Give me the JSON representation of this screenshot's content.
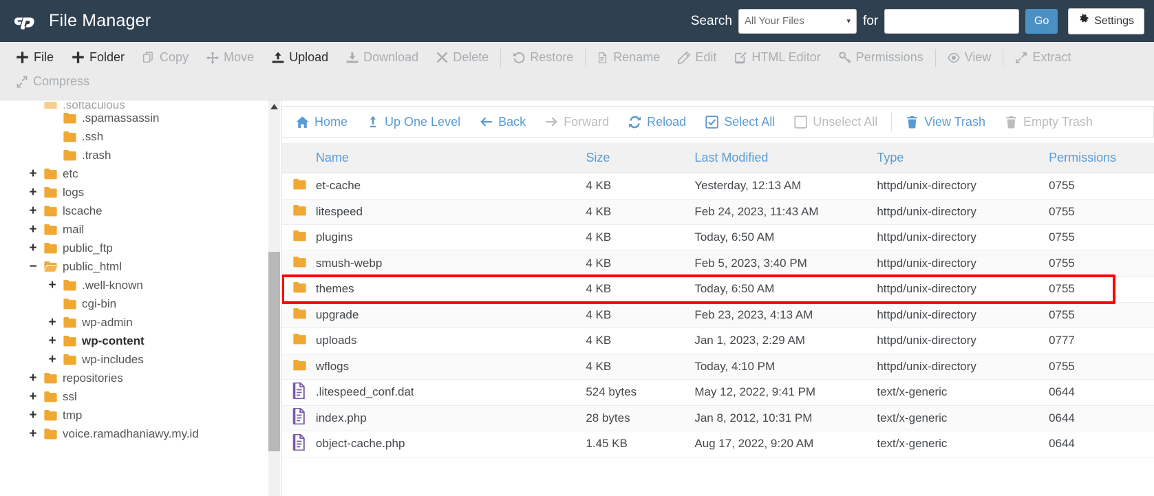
{
  "header": {
    "logo_icon": "cpanel-logo-icon",
    "title": "File Manager",
    "search_label": "Search",
    "search_scope_selected": "All Your Files",
    "search_for_label": "for",
    "search_value": "",
    "search_placeholder": "",
    "go_label": "Go",
    "settings_label": "Settings",
    "settings_icon": "gear-icon",
    "bg_color": "#2f4050",
    "go_color": "#4a90c4"
  },
  "toolbar": {
    "items": [
      {
        "label": "File",
        "icon": "plus-icon",
        "enabled": true
      },
      {
        "label": "Folder",
        "icon": "plus-icon",
        "enabled": true
      },
      {
        "label": "Copy",
        "icon": "copy-icon",
        "enabled": false
      },
      {
        "label": "Move",
        "icon": "move-arrows-icon",
        "enabled": false
      },
      {
        "label": "Upload",
        "icon": "upload-icon",
        "enabled": true
      },
      {
        "label": "Download",
        "icon": "download-icon",
        "enabled": false
      },
      {
        "label": "Delete",
        "icon": "close-x-icon",
        "enabled": false
      },
      {
        "label": "Restore",
        "icon": "restore-undo-icon",
        "enabled": false
      },
      {
        "label": "Rename",
        "icon": "file-icon",
        "enabled": false
      },
      {
        "label": "Edit",
        "icon": "pencil-icon",
        "enabled": false
      },
      {
        "label": "HTML Editor",
        "icon": "html-editor-icon",
        "enabled": false
      },
      {
        "label": "Permissions",
        "icon": "key-icon",
        "enabled": false
      },
      {
        "label": "View",
        "icon": "eye-icon",
        "enabled": false
      },
      {
        "label": "Extract",
        "icon": "extract-arrows-icon",
        "enabled": false
      }
    ],
    "row2": [
      {
        "label": "Compress",
        "icon": "compress-arrows-icon",
        "enabled": false
      }
    ]
  },
  "sidebar": {
    "items": [
      {
        "label": ".softaculous",
        "expander": "",
        "indent": 0,
        "clipped": true,
        "bold": false,
        "open": false
      },
      {
        "label": ".spamassassin",
        "expander": "",
        "indent": 1,
        "clipped": false,
        "bold": false,
        "open": false
      },
      {
        "label": ".ssh",
        "expander": "",
        "indent": 1,
        "clipped": false,
        "bold": false,
        "open": false
      },
      {
        "label": ".trash",
        "expander": "",
        "indent": 1,
        "clipped": false,
        "bold": false,
        "open": false
      },
      {
        "label": "etc",
        "expander": "+",
        "indent": 0,
        "clipped": false,
        "bold": false,
        "open": false
      },
      {
        "label": "logs",
        "expander": "+",
        "indent": 0,
        "clipped": false,
        "bold": false,
        "open": false
      },
      {
        "label": "lscache",
        "expander": "+",
        "indent": 0,
        "clipped": false,
        "bold": false,
        "open": false
      },
      {
        "label": "mail",
        "expander": "+",
        "indent": 0,
        "clipped": false,
        "bold": false,
        "open": false
      },
      {
        "label": "public_ftp",
        "expander": "+",
        "indent": 0,
        "clipped": false,
        "bold": false,
        "open": false
      },
      {
        "label": "public_html",
        "expander": "−",
        "indent": 0,
        "clipped": false,
        "bold": false,
        "open": true
      },
      {
        "label": ".well-known",
        "expander": "+",
        "indent": 1,
        "clipped": false,
        "bold": false,
        "open": false
      },
      {
        "label": "cgi-bin",
        "expander": "",
        "indent": 1,
        "clipped": false,
        "bold": false,
        "open": false
      },
      {
        "label": "wp-admin",
        "expander": "+",
        "indent": 1,
        "clipped": false,
        "bold": false,
        "open": false
      },
      {
        "label": "wp-content",
        "expander": "+",
        "indent": 1,
        "clipped": false,
        "bold": true,
        "open": false
      },
      {
        "label": "wp-includes",
        "expander": "+",
        "indent": 1,
        "clipped": false,
        "bold": false,
        "open": false
      },
      {
        "label": "repositories",
        "expander": "+",
        "indent": 0,
        "clipped": false,
        "bold": false,
        "open": false
      },
      {
        "label": "ssl",
        "expander": "+",
        "indent": 0,
        "clipped": false,
        "bold": false,
        "open": false
      },
      {
        "label": "tmp",
        "expander": "+",
        "indent": 0,
        "clipped": false,
        "bold": false,
        "open": false
      },
      {
        "label": "voice.ramadhaniawy.my.id",
        "expander": "+",
        "indent": 0,
        "clipped": false,
        "bold": false,
        "open": false
      }
    ]
  },
  "navbar": {
    "items": [
      {
        "label": "Home",
        "icon": "home-icon",
        "enabled": true
      },
      {
        "label": "Up One Level",
        "icon": "up-arrow-icon",
        "enabled": true
      },
      {
        "label": "Back",
        "icon": "arrow-left-icon",
        "enabled": true
      },
      {
        "label": "Forward",
        "icon": "arrow-right-icon",
        "enabled": false
      },
      {
        "label": "Reload",
        "icon": "reload-icon",
        "enabled": true
      },
      {
        "label": "Select All",
        "icon": "checkbox-checked-icon",
        "enabled": true
      },
      {
        "label": "Unselect All",
        "icon": "checkbox-empty-icon",
        "enabled": false
      }
    ],
    "trash_items": [
      {
        "label": "View Trash",
        "icon": "trash-icon",
        "enabled": true
      },
      {
        "label": "Empty Trash",
        "icon": "trash-icon",
        "enabled": false
      }
    ]
  },
  "table": {
    "columns": [
      "Name",
      "Size",
      "Last Modified",
      "Type",
      "Permissions"
    ],
    "rows": [
      {
        "icon": "folder-icon",
        "name": "et-cache",
        "size": "4 KB",
        "modified": "Yesterday, 12:13 AM",
        "type": "httpd/unix-directory",
        "permissions": "0755",
        "highlighted": false
      },
      {
        "icon": "folder-icon",
        "name": "litespeed",
        "size": "4 KB",
        "modified": "Feb 24, 2023, 11:43 AM",
        "type": "httpd/unix-directory",
        "permissions": "0755",
        "highlighted": false
      },
      {
        "icon": "folder-icon",
        "name": "plugins",
        "size": "4 KB",
        "modified": "Today, 6:50 AM",
        "type": "httpd/unix-directory",
        "permissions": "0755",
        "highlighted": false
      },
      {
        "icon": "folder-icon",
        "name": "smush-webp",
        "size": "4 KB",
        "modified": "Feb 5, 2023, 3:40 PM",
        "type": "httpd/unix-directory",
        "permissions": "0755",
        "highlighted": false
      },
      {
        "icon": "folder-icon",
        "name": "themes",
        "size": "4 KB",
        "modified": "Today, 6:50 AM",
        "type": "httpd/unix-directory",
        "permissions": "0755",
        "highlighted": true
      },
      {
        "icon": "folder-icon",
        "name": "upgrade",
        "size": "4 KB",
        "modified": "Feb 23, 2023, 4:13 AM",
        "type": "httpd/unix-directory",
        "permissions": "0755",
        "highlighted": false
      },
      {
        "icon": "folder-icon",
        "name": "uploads",
        "size": "4 KB",
        "modified": "Jan 1, 2023, 2:29 AM",
        "type": "httpd/unix-directory",
        "permissions": "0777",
        "highlighted": false
      },
      {
        "icon": "folder-icon",
        "name": "wflogs",
        "size": "4 KB",
        "modified": "Today, 4:10 PM",
        "type": "httpd/unix-directory",
        "permissions": "0755",
        "highlighted": false
      },
      {
        "icon": "file-icon",
        "name": ".litespeed_conf.dat",
        "size": "524 bytes",
        "modified": "May 12, 2022, 9:41 PM",
        "type": "text/x-generic",
        "permissions": "0644",
        "highlighted": false
      },
      {
        "icon": "file-icon",
        "name": "index.php",
        "size": "28 bytes",
        "modified": "Jan 8, 2012, 10:31 PM",
        "type": "text/x-generic",
        "permissions": "0644",
        "highlighted": false
      },
      {
        "icon": "file-icon",
        "name": "object-cache.php",
        "size": "1.45 KB",
        "modified": "Aug 17, 2022, 9:20 AM",
        "type": "text/x-generic",
        "permissions": "0644",
        "highlighted": false
      }
    ]
  },
  "annotation": {
    "highlight_color": "#ff0000",
    "highlight_target": "themes"
  }
}
